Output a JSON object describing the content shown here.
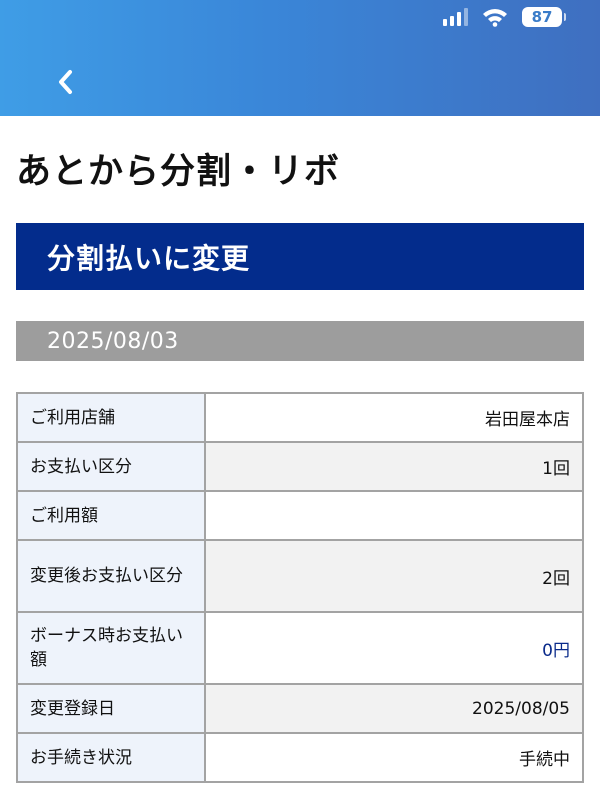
{
  "status_bar": {
    "battery_level": "87",
    "signal_bars": 4,
    "signal_bars_active": 3
  },
  "nav": {
    "back_icon": "chevron-left-icon"
  },
  "page": {
    "title": "あとから分割・リボ"
  },
  "section": {
    "header": "分割払いに変更",
    "date": "2025/08/03"
  },
  "details": [
    {
      "label": "ご利用店舗",
      "value": "岩田屋本店"
    },
    {
      "label": "お支払い区分",
      "value": "1回"
    },
    {
      "label": "ご利用額",
      "value": ""
    },
    {
      "label": "変更後お支払い区分",
      "value": "2回"
    },
    {
      "label": "ボーナス時お支払い額",
      "value": "0円"
    },
    {
      "label": "変更登録日",
      "value": "2025/08/05"
    },
    {
      "label": "お手続き状況",
      "value": "手続中"
    }
  ],
  "colors": {
    "header_gradient_start": "#3f9de6",
    "header_gradient_end": "#3f6fc0",
    "section_header_bg": "#032c8c",
    "date_bar_bg": "#9d9d9d",
    "table_label_bg": "#eef3fb",
    "table_border": "#a3a3a3",
    "amount_text": "#0a2a8a"
  }
}
